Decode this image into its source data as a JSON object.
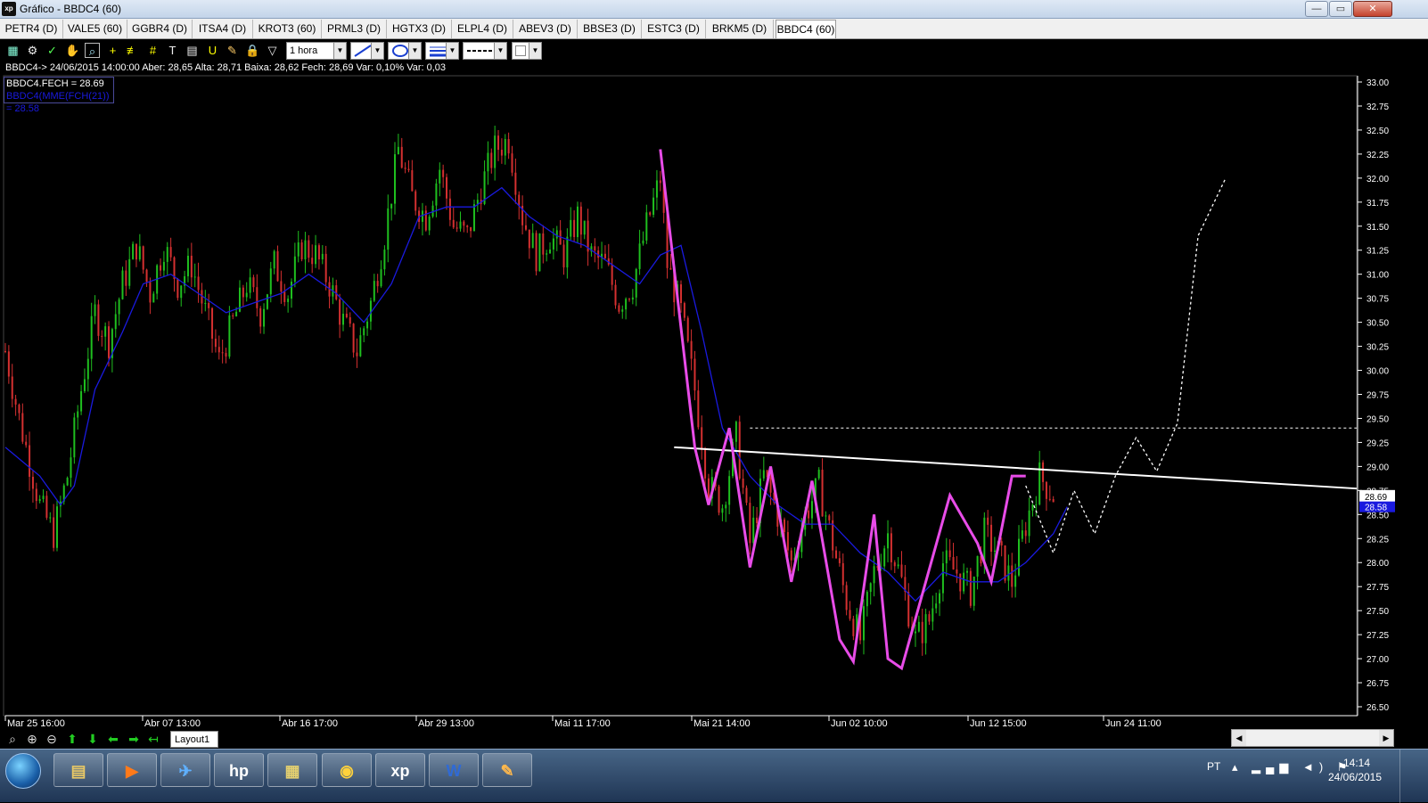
{
  "window": {
    "title": "Gráfico - BBDC4 (60)",
    "app_badge": "xp",
    "btn_min": "—",
    "btn_max": "▭",
    "btn_close": "✕"
  },
  "tabs": [
    {
      "label": "PETR4 (D)"
    },
    {
      "label": "VALE5 (60)"
    },
    {
      "label": "GGBR4 (D)"
    },
    {
      "label": "ITSA4 (D)"
    },
    {
      "label": "KROT3 (60)"
    },
    {
      "label": "PRML3 (D)"
    },
    {
      "label": "HGTX3 (D)"
    },
    {
      "label": "ELPL4 (D)"
    },
    {
      "label": "ABEV3 (D)"
    },
    {
      "label": "BBSE3 (D)"
    },
    {
      "label": "ESTC3 (D)"
    },
    {
      "label": "BRKM5 (D)"
    },
    {
      "label": "BBDC4 (60)",
      "active": true
    }
  ],
  "toolbar": {
    "icons": [
      "chart-type-icon",
      "settings-gear-icon",
      "indicator-icon",
      "hand-pan-icon",
      "zoom-area-icon",
      "crosshair-icon",
      "fibonacci-icon",
      "grid-lines-icon",
      "text-tool-icon",
      "magnet-icon",
      "eraser-icon",
      "lock-icon",
      "filter-icon"
    ],
    "period_value": "1 hora",
    "line_color": "#1a3fd0"
  },
  "info": {
    "quote_line": "BBDC4-> 24/06/2015 14:00:00 Aber: 28,65 Alta: 28,71 Baixa: 28,62 Fech: 28,69 Var: 0,10% Var: 0,03",
    "legend_close": "BBDC4.FECH = 28.69",
    "legend_ma": "BBDC4(MME(FCH(21)) = 28.58"
  },
  "chart_data": {
    "type": "candlestick",
    "symbol": "BBDC4",
    "interval": "60 min",
    "ylim": [
      26.5,
      33.0
    ],
    "y_ticks": [
      "33.00",
      "32.75",
      "32.50",
      "32.25",
      "32.00",
      "31.75",
      "31.50",
      "31.25",
      "31.00",
      "30.75",
      "30.50",
      "30.25",
      "30.00",
      "29.75",
      "29.50",
      "29.25",
      "29.00",
      "28.75",
      "28.50",
      "28.25",
      "28.00",
      "27.75",
      "27.50",
      "27.25",
      "27.00",
      "26.75",
      "26.50"
    ],
    "x_labels": [
      "Mar 25 16:00",
      "Abr 07 13:00",
      "Abr 16 17:00",
      "Abr 29 13:00",
      "Mai 11 17:00",
      "Mai 21 14:00",
      "Jun 02 10:00",
      "Jun 12 15:00",
      "Jun 24 11:00"
    ],
    "last_close": 28.69,
    "last_close_label": "28.69",
    "ma_value": 28.58,
    "ma_label": "28.58",
    "price_path": [
      [
        0,
        30.2
      ],
      [
        2,
        29.5
      ],
      [
        5,
        28.6
      ],
      [
        7,
        28.3
      ],
      [
        9,
        28.9
      ],
      [
        11,
        29.8
      ],
      [
        13,
        30.6
      ],
      [
        15,
        30.3
      ],
      [
        17,
        30.9
      ],
      [
        19,
        31.3
      ],
      [
        21,
        30.8
      ],
      [
        23,
        31.3
      ],
      [
        25,
        30.9
      ],
      [
        27,
        31.1
      ],
      [
        29,
        30.6
      ],
      [
        31,
        30.1
      ],
      [
        33,
        30.5
      ],
      [
        35,
        30.9
      ],
      [
        37,
        30.6
      ],
      [
        39,
        31.1
      ],
      [
        41,
        30.8
      ],
      [
        43,
        31.3
      ],
      [
        45,
        31.2
      ],
      [
        47,
        30.9
      ],
      [
        49,
        30.5
      ],
      [
        51,
        30.2
      ],
      [
        53,
        30.7
      ],
      [
        55,
        31.4
      ],
      [
        57,
        32.3
      ],
      [
        59,
        31.8
      ],
      [
        61,
        31.6
      ],
      [
        63,
        32.1
      ],
      [
        65,
        31.5
      ],
      [
        67,
        31.4
      ],
      [
        69,
        31.9
      ],
      [
        71,
        32.3
      ],
      [
        73,
        32.4
      ],
      [
        75,
        31.6
      ],
      [
        77,
        31.2
      ],
      [
        79,
        31.4
      ],
      [
        81,
        31.2
      ],
      [
        83,
        31.6
      ],
      [
        85,
        31.2
      ],
      [
        87,
        31.1
      ],
      [
        89,
        30.7
      ],
      [
        91,
        30.9
      ],
      [
        93,
        31.5
      ],
      [
        95,
        32.0
      ],
      [
        96,
        31.1
      ],
      [
        98,
        30.6
      ],
      [
        100,
        29.8
      ],
      [
        102,
        28.8
      ],
      [
        104,
        28.6
      ],
      [
        106,
        29.3
      ],
      [
        108,
        28.2
      ],
      [
        110,
        28.9
      ],
      [
        112,
        28.5
      ],
      [
        114,
        28.0
      ],
      [
        116,
        28.5
      ],
      [
        118,
        28.8
      ],
      [
        120,
        28.2
      ],
      [
        122,
        27.6
      ],
      [
        124,
        27.2
      ],
      [
        126,
        27.9
      ],
      [
        128,
        28.3
      ],
      [
        130,
        27.8
      ],
      [
        132,
        27.2
      ],
      [
        134,
        27.4
      ],
      [
        136,
        28.0
      ],
      [
        138,
        27.9
      ],
      [
        140,
        27.7
      ],
      [
        142,
        28.3
      ],
      [
        144,
        28.1
      ],
      [
        146,
        27.8
      ],
      [
        148,
        28.4
      ],
      [
        150,
        28.9
      ],
      [
        152,
        28.7
      ]
    ],
    "ma_path": [
      [
        0,
        29.2
      ],
      [
        5,
        28.9
      ],
      [
        8,
        28.6
      ],
      [
        10,
        28.8
      ],
      [
        13,
        29.8
      ],
      [
        17,
        30.4
      ],
      [
        20,
        30.9
      ],
      [
        24,
        31.0
      ],
      [
        28,
        30.8
      ],
      [
        32,
        30.6
      ],
      [
        36,
        30.7
      ],
      [
        40,
        30.8
      ],
      [
        44,
        31.0
      ],
      [
        48,
        30.8
      ],
      [
        52,
        30.5
      ],
      [
        56,
        30.9
      ],
      [
        60,
        31.6
      ],
      [
        64,
        31.7
      ],
      [
        68,
        31.7
      ],
      [
        72,
        31.9
      ],
      [
        76,
        31.6
      ],
      [
        80,
        31.4
      ],
      [
        84,
        31.3
      ],
      [
        88,
        31.1
      ],
      [
        92,
        30.9
      ],
      [
        95,
        31.2
      ],
      [
        98,
        31.3
      ],
      [
        101,
        30.4
      ],
      [
        104,
        29.4
      ],
      [
        108,
        28.9
      ],
      [
        112,
        28.6
      ],
      [
        116,
        28.4
      ],
      [
        120,
        28.4
      ],
      [
        124,
        28.1
      ],
      [
        128,
        27.9
      ],
      [
        132,
        27.6
      ],
      [
        136,
        27.9
      ],
      [
        140,
        27.8
      ],
      [
        144,
        27.8
      ],
      [
        148,
        28.0
      ],
      [
        152,
        28.3
      ],
      [
        154,
        28.58
      ]
    ],
    "drawings": {
      "neckline": {
        "x1": 97,
        "y1": 29.2,
        "x2": 196,
        "y2": 28.77
      },
      "resistance": {
        "x1": 108,
        "x2": 196,
        "y": 29.4
      },
      "zigzag": [
        [
          95,
          32.3
        ],
        [
          100,
          29.2
        ],
        [
          102,
          28.6
        ],
        [
          105,
          29.4
        ],
        [
          108,
          27.95
        ],
        [
          111,
          29.0
        ],
        [
          114,
          27.8
        ],
        [
          117,
          28.85
        ],
        [
          121,
          27.2
        ],
        [
          123,
          26.97
        ],
        [
          126,
          28.5
        ],
        [
          128,
          27.0
        ],
        [
          130,
          26.9
        ],
        [
          137,
          28.7
        ],
        [
          141,
          28.2
        ],
        [
          143,
          27.8
        ],
        [
          146,
          28.9
        ],
        [
          148,
          28.9
        ]
      ],
      "projection": [
        [
          148,
          28.8
        ],
        [
          152,
          28.1
        ],
        [
          155,
          28.75
        ],
        [
          158,
          28.3
        ],
        [
          161,
          28.9
        ],
        [
          164,
          29.3
        ],
        [
          167,
          28.95
        ],
        [
          170,
          29.45
        ],
        [
          173,
          31.4
        ],
        [
          177,
          32.0
        ]
      ]
    },
    "colors": {
      "up": "#1fbf1f",
      "down": "#d43030",
      "ma": "#1a1adf",
      "zigzag": "#e84ce8",
      "drawing": "#ffffff"
    }
  },
  "bottom": {
    "layout_tab": "Layout1",
    "scroll_left": "◀",
    "scroll_right": "▶"
  },
  "taskbar": {
    "apps": [
      {
        "name": "explorer-taskbar-button",
        "glyph": "▤",
        "color": "#e8c866"
      },
      {
        "name": "media-player-taskbar-button",
        "glyph": "▶",
        "color": "#ff7a1a"
      },
      {
        "name": "network-app-taskbar-button",
        "glyph": "✈",
        "color": "#5fb0ff"
      },
      {
        "name": "hp-app-taskbar-button",
        "glyph": "hp",
        "color": "#ffffff"
      },
      {
        "name": "scanner-app-taskbar-button",
        "glyph": "▦",
        "color": "#e4d070"
      },
      {
        "name": "chrome-taskbar-button",
        "glyph": "◉",
        "color": "#ffd23c"
      },
      {
        "name": "xp-platform-taskbar-button",
        "glyph": "xp",
        "color": "#ffffff"
      },
      {
        "name": "word-taskbar-button",
        "glyph": "W",
        "color": "#2f6ad6"
      },
      {
        "name": "paint-taskbar-button",
        "glyph": "✎",
        "color": "#ffb84c"
      }
    ],
    "lang": "PT",
    "tray": "▴ ▂▄▆ ◄) ⚑",
    "time": "14:14",
    "date": "24/06/2015"
  }
}
